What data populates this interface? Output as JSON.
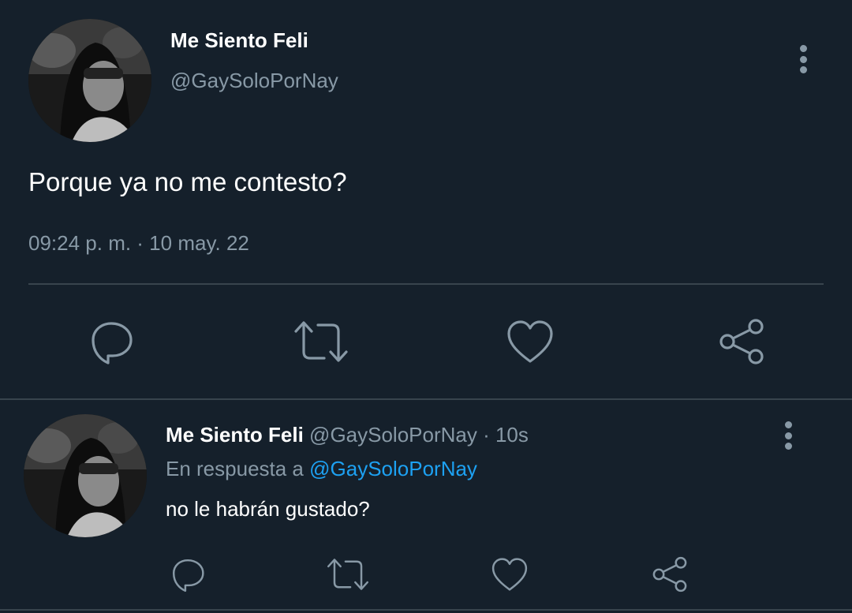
{
  "main_tweet": {
    "author_name": "Me Siento Feli",
    "author_handle": "@GaySoloPorNay",
    "text": "Porque ya no me contesto?",
    "timestamp": "09:24 p. m. · 10 may. 22",
    "actions": [
      "reply-icon",
      "retweet-icon",
      "like-icon",
      "share-icon"
    ]
  },
  "reply_tweet": {
    "author_name": "Me Siento Feli",
    "author_handle": "@GaySoloPorNay",
    "time_ago": "· 10s",
    "reply_prefix": "En respuesta a",
    "reply_to": "@GaySoloPorNay",
    "text": "no le habrán gustado?",
    "actions": [
      "reply-icon",
      "retweet-icon",
      "like-icon",
      "share-icon"
    ]
  },
  "colors": {
    "background": "#15202b",
    "muted": "#8899a6",
    "link": "#1da1f2",
    "divider": "#38444d"
  }
}
